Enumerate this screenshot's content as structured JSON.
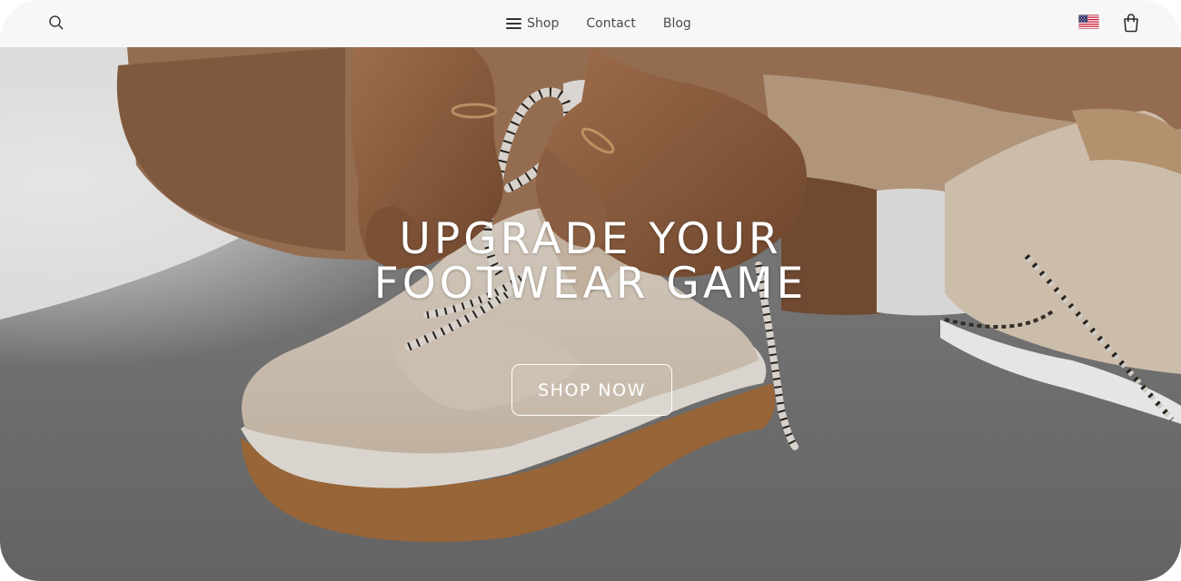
{
  "header": {
    "nav": {
      "shop_label": "Shop",
      "contact_label": "Contact",
      "blog_label": "Blog"
    },
    "icons": {
      "search": "search-icon",
      "menu": "hamburger-menu-icon",
      "flag": "us-flag-icon",
      "cart": "shopping-bag-icon"
    }
  },
  "hero": {
    "headline_line1": "UPGRADE YOUR",
    "headline_line2": "FOOTWEAR GAME",
    "cta_label": "SHOP NOW",
    "image_alt": "Hands tying laces of a beige chunky sneaker on a grey mat"
  },
  "colors": {
    "header_bg": "#f7f7f7",
    "nav_text": "#4a4a4a",
    "hero_text": "#ffffff"
  }
}
